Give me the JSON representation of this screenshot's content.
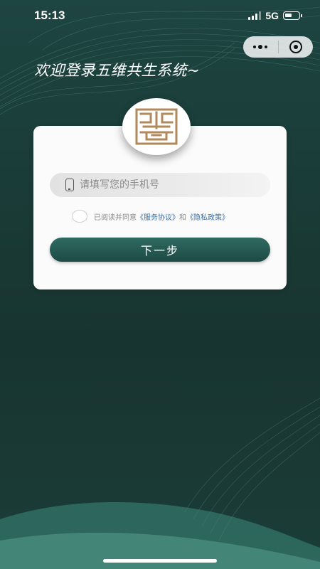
{
  "status_bar": {
    "time": "15:13",
    "network": "5G"
  },
  "capsule": {
    "menu_icon": "more-dots-icon",
    "close_icon": "target-circle-icon"
  },
  "welcome_text": "欢迎登录五维共生系统~",
  "logo": {
    "icon": "seal-logo-icon",
    "color": "#b08a5a"
  },
  "login_form": {
    "phone_placeholder": "请填写您的手机号",
    "phone_value": "",
    "agreement_prefix": "已阅读并同意",
    "service_link": "《服务协议》",
    "and_text": "和",
    "privacy_link": "《隐私政策》",
    "agreement_checked": false,
    "next_button_label": "下一步"
  },
  "colors": {
    "accent": "#1f4b45",
    "link": "#3a6ea5",
    "background": "#1a3b37"
  }
}
